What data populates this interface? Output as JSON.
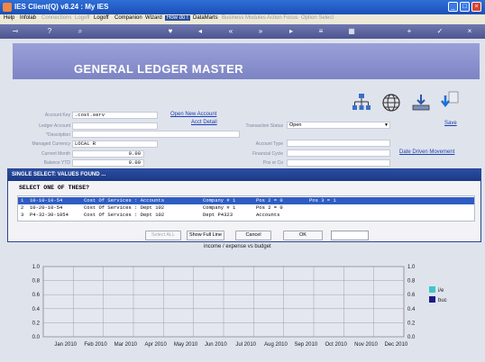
{
  "window": {
    "title": "IES Client(Q) v8.24 : My IES"
  },
  "menu": {
    "items": [
      {
        "label": "Help",
        "state": "normal"
      },
      {
        "label": "Infolab",
        "state": "normal"
      },
      {
        "label": "Connections",
        "state": "disabled"
      },
      {
        "label": "Logoff",
        "state": "disabled"
      },
      {
        "label": "Logoff",
        "state": "normal"
      },
      {
        "label": "Companion",
        "state": "normal"
      },
      {
        "label": "Wizard",
        "state": "normal"
      },
      {
        "label": "How do I",
        "state": "active"
      },
      {
        "label": "DataMarts",
        "state": "normal"
      },
      {
        "label": "Business Modules",
        "state": "disabled"
      },
      {
        "label": "Action Focus",
        "state": "disabled"
      },
      {
        "label": "Option Select",
        "state": "disabled"
      }
    ]
  },
  "banner": {
    "title": "GENERAL LEDGER MASTER"
  },
  "form": {
    "account_key_label": "Account Key",
    "account_key_value": ".cost.serv",
    "ledger_account_label": "Ledger Account",
    "description_label": "*Description",
    "managed_currency_label": "Managed Currency",
    "managed_currency_value": "LOCAL R",
    "current_month_label": "Current Month",
    "current_month_value": "0.00",
    "balance_ytd_label": "Balance YTD",
    "balance_ytd_value": "0.00",
    "transaction_status_label": "Transaction Status",
    "transaction_status_value": "Open",
    "account_type_label": "Account Type",
    "financial_cycle_label": "Financial Cycle",
    "pos_label": "Pos or Co"
  },
  "links": {
    "open_new_account": "Open New Account",
    "acct_detail": "Acct Detail",
    "save": "Save",
    "date_driven_movement": "Date Driven Movement"
  },
  "dialog": {
    "title": "SINGLE SELECT: VALUES FOUND ...",
    "prompt": "SELECT ONE OF THESE?",
    "rows": [
      {
        "num": "1",
        "code": "10-10-10-54",
        "desc": "Cost Of Services : Accounts",
        "c3": "Company # 1",
        "c4": "Pos 2 = 0",
        "c5": "Pos 3 = 1"
      },
      {
        "num": "2",
        "code": "10-20-10-54",
        "desc": "Cost Of Services : Dept 102",
        "c3": "Company # 1",
        "c4": "Pos 2 = 0",
        "c5": ""
      },
      {
        "num": "3",
        "code": "P4-32-30-1054",
        "desc": "Cost Of Services : Dept 102",
        "c3": "Dept P4323",
        "c4": "Accounts",
        "c5": ""
      }
    ],
    "selected_index": 0,
    "buttons": {
      "select_all": "Select ALL",
      "show_full_line": "Show Full Line",
      "cancel": "Cancel",
      "ok": "OK"
    }
  },
  "chart_data": {
    "type": "bar",
    "title": "income / expense vs budget",
    "categories": [
      "Jan 2010",
      "Feb 2010",
      "Mar 2010",
      "Apr 2010",
      "May 2010",
      "Jun 2010",
      "Jul 2010",
      "Aug 2010",
      "Sep 2010",
      "Oct 2010",
      "Nov 2010",
      "Dec 2010"
    ],
    "series": [
      {
        "name": "i/e",
        "values": [
          0,
          0,
          0,
          0,
          0,
          0,
          0,
          0,
          0,
          0,
          0,
          0
        ],
        "color": "#3cc8c8"
      },
      {
        "name": "buc",
        "values": [
          0,
          0,
          0,
          0,
          0,
          0,
          0,
          0,
          0,
          0,
          0,
          0
        ],
        "color": "#1a1a8c"
      }
    ],
    "yticks": [
      "1.0",
      "0.8",
      "0.6",
      "0.4",
      "0.2",
      "0.0"
    ],
    "ylim": [
      0,
      1.0
    ],
    "grid": true,
    "legend_placement": "right"
  },
  "colors": {
    "title_bar": "#1a4fb8",
    "banner": "#7d84c4",
    "dialog_header": "#1d3882",
    "selection": "#2e5cc3",
    "link": "#1d3fb0"
  }
}
